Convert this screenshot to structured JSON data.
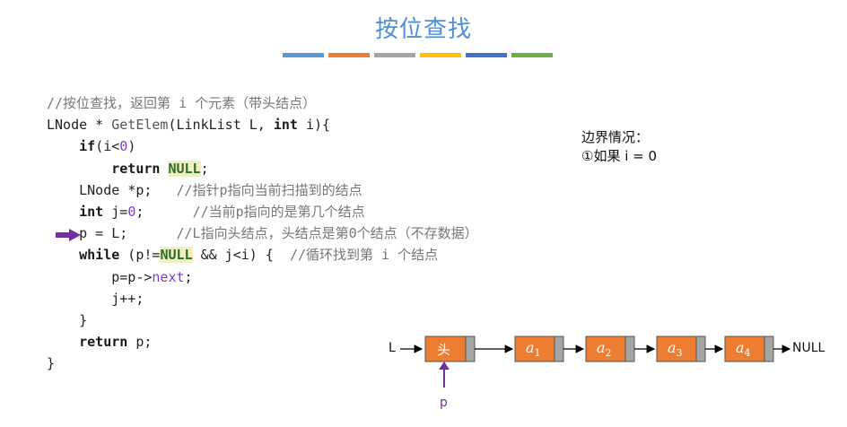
{
  "title": "按位查找",
  "accent_colors": [
    "#5b9bd5",
    "#ed7d31",
    "#a5a5a5",
    "#ffc000",
    "#4472c4",
    "#70ad47"
  ],
  "code": {
    "line1": "//按位查找，返回第 i 个元素（带头结点）",
    "line2_type": "LNode",
    "line2_star": " * ",
    "line2_fn": "GetElem",
    "line2_open": "(LinkList L, ",
    "line2_int": "int",
    "line2_close": " i){",
    "line3_if": "if",
    "line3_cond_a": "(i<",
    "line3_zero": "0",
    "line3_cond_b": ")",
    "line4_return": "return",
    "line4_null": "NULL",
    "line4_end": ";",
    "line5_code": "LNode *p;",
    "line5_comment": "//指针p指向当前扫描到的结点",
    "line6_int": "int",
    "line6_code_a": " j=",
    "line6_zero": "0",
    "line6_code_b": ";",
    "line6_comment": "//当前p指向的是第几个结点",
    "line7_code": "p = L;",
    "line7_comment": "//L指向头结点，头结点是第0个结点（不存数据）",
    "line8_while": "while",
    "line8_a": " (p!=",
    "line8_null": "NULL",
    "line8_b": " && j<i) {",
    "line8_comment": "//循环找到第 i 个结点",
    "line9_a": "p=p->",
    "line9_next": "next",
    "line9_b": ";",
    "line10": "j++;",
    "line11": "}",
    "line12_return": "return",
    "line12_b": " p;",
    "line13": "}"
  },
  "notes": {
    "line1": "边界情况：",
    "line2": "①如果 i = 0"
  },
  "diagram": {
    "l_label": "L",
    "head_label": "头",
    "nodes": [
      "a1",
      "a2",
      "a3",
      "a4"
    ],
    "node_letter": "a",
    "node_subs": [
      "1",
      "2",
      "3",
      "4"
    ],
    "null_label": "NULL",
    "p_label": "p",
    "node_fill": "#ed7d31",
    "next_fill": "#a5a5a5",
    "pointer_color": "#7030a0"
  }
}
